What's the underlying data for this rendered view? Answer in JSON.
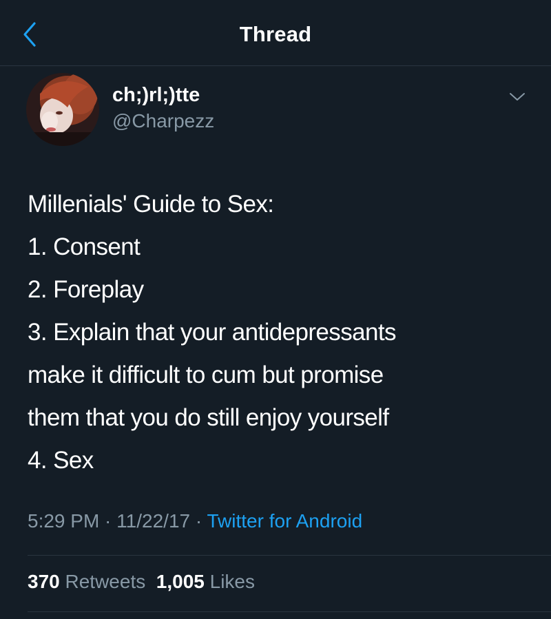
{
  "header": {
    "title": "Thread",
    "back_icon": "chevron-left-icon"
  },
  "tweet": {
    "author": {
      "display_name": "ch;)rl;)tte",
      "handle": "@Charpezz"
    },
    "menu_icon": "chevron-down-icon",
    "lines": [
      "Millenials' Guide to Sex:",
      "1. Consent",
      "2. Foreplay",
      "3. Explain that your antidepressants",
      "make it difficult to cum but promise",
      "them that you do still enjoy yourself",
      "4. Sex"
    ],
    "meta": {
      "time": "5:29 PM",
      "separator": " · ",
      "date": "11/22/17",
      "source": "Twitter for Android"
    },
    "stats": {
      "retweets_count": "370",
      "retweets_label": "Retweets",
      "likes_count": "1,005",
      "likes_label": "Likes"
    }
  },
  "colors": {
    "background": "#141d26",
    "text_primary": "#ffffff",
    "text_secondary": "#8899a6",
    "accent": "#1da1f2",
    "divider": "#2a3540"
  }
}
